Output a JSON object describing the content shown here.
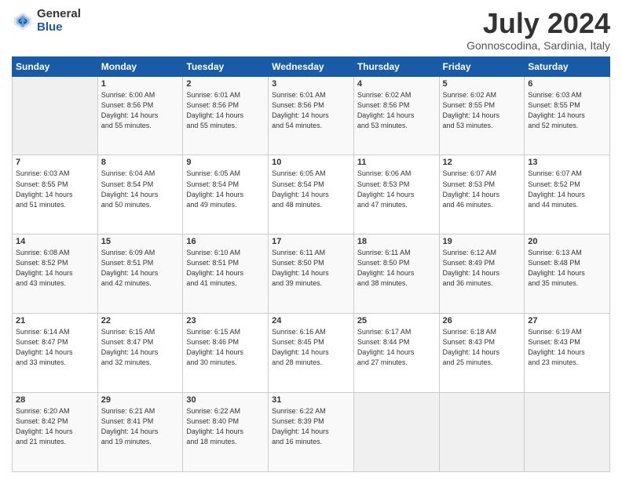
{
  "logo": {
    "general": "General",
    "blue": "Blue"
  },
  "title": "July 2024",
  "subtitle": "Gonnoscodina, Sardinia, Italy",
  "headers": [
    "Sunday",
    "Monday",
    "Tuesday",
    "Wednesday",
    "Thursday",
    "Friday",
    "Saturday"
  ],
  "weeks": [
    [
      {
        "day": "",
        "info": ""
      },
      {
        "day": "1",
        "info": "Sunrise: 6:00 AM\nSunset: 8:56 PM\nDaylight: 14 hours\nand 55 minutes."
      },
      {
        "day": "2",
        "info": "Sunrise: 6:01 AM\nSunset: 8:56 PM\nDaylight: 14 hours\nand 55 minutes."
      },
      {
        "day": "3",
        "info": "Sunrise: 6:01 AM\nSunset: 8:56 PM\nDaylight: 14 hours\nand 54 minutes."
      },
      {
        "day": "4",
        "info": "Sunrise: 6:02 AM\nSunset: 8:56 PM\nDaylight: 14 hours\nand 53 minutes."
      },
      {
        "day": "5",
        "info": "Sunrise: 6:02 AM\nSunset: 8:55 PM\nDaylight: 14 hours\nand 53 minutes."
      },
      {
        "day": "6",
        "info": "Sunrise: 6:03 AM\nSunset: 8:55 PM\nDaylight: 14 hours\nand 52 minutes."
      }
    ],
    [
      {
        "day": "7",
        "info": "Sunrise: 6:03 AM\nSunset: 8:55 PM\nDaylight: 14 hours\nand 51 minutes."
      },
      {
        "day": "8",
        "info": "Sunrise: 6:04 AM\nSunset: 8:54 PM\nDaylight: 14 hours\nand 50 minutes."
      },
      {
        "day": "9",
        "info": "Sunrise: 6:05 AM\nSunset: 8:54 PM\nDaylight: 14 hours\nand 49 minutes."
      },
      {
        "day": "10",
        "info": "Sunrise: 6:05 AM\nSunset: 8:54 PM\nDaylight: 14 hours\nand 48 minutes."
      },
      {
        "day": "11",
        "info": "Sunrise: 6:06 AM\nSunset: 8:53 PM\nDaylight: 14 hours\nand 47 minutes."
      },
      {
        "day": "12",
        "info": "Sunrise: 6:07 AM\nSunset: 8:53 PM\nDaylight: 14 hours\nand 46 minutes."
      },
      {
        "day": "13",
        "info": "Sunrise: 6:07 AM\nSunset: 8:52 PM\nDaylight: 14 hours\nand 44 minutes."
      }
    ],
    [
      {
        "day": "14",
        "info": "Sunrise: 6:08 AM\nSunset: 8:52 PM\nDaylight: 14 hours\nand 43 minutes."
      },
      {
        "day": "15",
        "info": "Sunrise: 6:09 AM\nSunset: 8:51 PM\nDaylight: 14 hours\nand 42 minutes."
      },
      {
        "day": "16",
        "info": "Sunrise: 6:10 AM\nSunset: 8:51 PM\nDaylight: 14 hours\nand 41 minutes."
      },
      {
        "day": "17",
        "info": "Sunrise: 6:11 AM\nSunset: 8:50 PM\nDaylight: 14 hours\nand 39 minutes."
      },
      {
        "day": "18",
        "info": "Sunrise: 6:11 AM\nSunset: 8:50 PM\nDaylight: 14 hours\nand 38 minutes."
      },
      {
        "day": "19",
        "info": "Sunrise: 6:12 AM\nSunset: 8:49 PM\nDaylight: 14 hours\nand 36 minutes."
      },
      {
        "day": "20",
        "info": "Sunrise: 6:13 AM\nSunset: 8:48 PM\nDaylight: 14 hours\nand 35 minutes."
      }
    ],
    [
      {
        "day": "21",
        "info": "Sunrise: 6:14 AM\nSunset: 8:47 PM\nDaylight: 14 hours\nand 33 minutes."
      },
      {
        "day": "22",
        "info": "Sunrise: 6:15 AM\nSunset: 8:47 PM\nDaylight: 14 hours\nand 32 minutes."
      },
      {
        "day": "23",
        "info": "Sunrise: 6:15 AM\nSunset: 8:46 PM\nDaylight: 14 hours\nand 30 minutes."
      },
      {
        "day": "24",
        "info": "Sunrise: 6:16 AM\nSunset: 8:45 PM\nDaylight: 14 hours\nand 28 minutes."
      },
      {
        "day": "25",
        "info": "Sunrise: 6:17 AM\nSunset: 8:44 PM\nDaylight: 14 hours\nand 27 minutes."
      },
      {
        "day": "26",
        "info": "Sunrise: 6:18 AM\nSunset: 8:43 PM\nDaylight: 14 hours\nand 25 minutes."
      },
      {
        "day": "27",
        "info": "Sunrise: 6:19 AM\nSunset: 8:43 PM\nDaylight: 14 hours\nand 23 minutes."
      }
    ],
    [
      {
        "day": "28",
        "info": "Sunrise: 6:20 AM\nSunset: 8:42 PM\nDaylight: 14 hours\nand 21 minutes."
      },
      {
        "day": "29",
        "info": "Sunrise: 6:21 AM\nSunset: 8:41 PM\nDaylight: 14 hours\nand 19 minutes."
      },
      {
        "day": "30",
        "info": "Sunrise: 6:22 AM\nSunset: 8:40 PM\nDaylight: 14 hours\nand 18 minutes."
      },
      {
        "day": "31",
        "info": "Sunrise: 6:22 AM\nSunset: 8:39 PM\nDaylight: 14 hours\nand 16 minutes."
      },
      {
        "day": "",
        "info": ""
      },
      {
        "day": "",
        "info": ""
      },
      {
        "day": "",
        "info": ""
      }
    ]
  ]
}
